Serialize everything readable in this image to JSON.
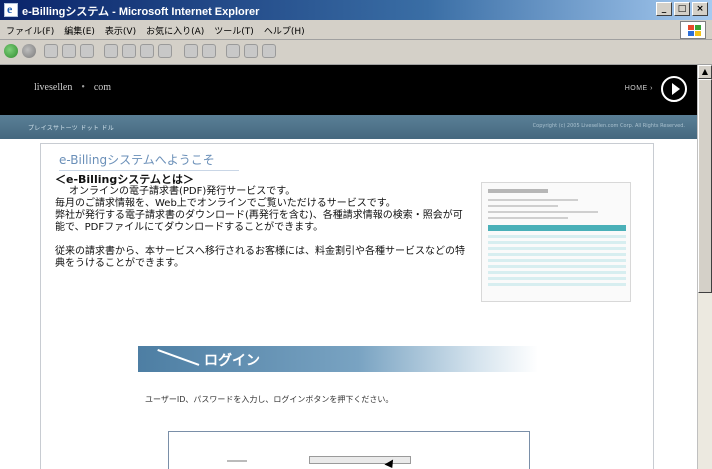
{
  "window": {
    "title": "e-Billingシステム - Microsoft Internet Explorer",
    "controls": {
      "minimize": "_",
      "maximize": "□",
      "close": "×"
    }
  },
  "menubar": {
    "items": [
      "ファイル(F)",
      "編集(E)",
      "表示(V)",
      "お気に入り(A)",
      "ツール(T)",
      "ヘルプ(H)"
    ]
  },
  "site": {
    "brand": "livesellen",
    "brand_suffix": "com",
    "brand_separator": "•",
    "home_label": "HOME ›",
    "subbar_left": "プレイスサトーツ ドット ドル",
    "subbar_right": "Copyright (c) 2005 Livesellen.com Corp. All Rights Reserved."
  },
  "content": {
    "welcome": "e-Billingシステムへようこそ",
    "intro_heading": "＜e-Billingシステムとは＞",
    "intro_lines": [
      "オンラインの電子請求書(PDF)発行サービスです。",
      "毎月のご請求情報を、Web上でオンラインでご覧いただけるサービスです。",
      "弊社が発行する電子請求書のダウンロード(再発行を含む)、各種請求情報の検索・照会が可能で、PDFファイルにてダウンロードすることができます。",
      "従来の請求書から、本サービスへ移行されるお客様には、料金割引や各種サービスなどの特典をうけることができます。"
    ],
    "login_title": "ログイン",
    "login_hint": "ユーザーID、パスワードを入力し、ログインボタンを押下ください。"
  },
  "colors": {
    "header_bg": "#000000",
    "subbar": "#4f7388",
    "login_bar": "#4d7ea3",
    "welcome_text": "#6a8fb8"
  },
  "icons": {
    "home": "play-circle-icon",
    "back": "back-arrow-icon",
    "forward": "forward-arrow-icon",
    "ie_logo": "windows-flag-icon"
  }
}
